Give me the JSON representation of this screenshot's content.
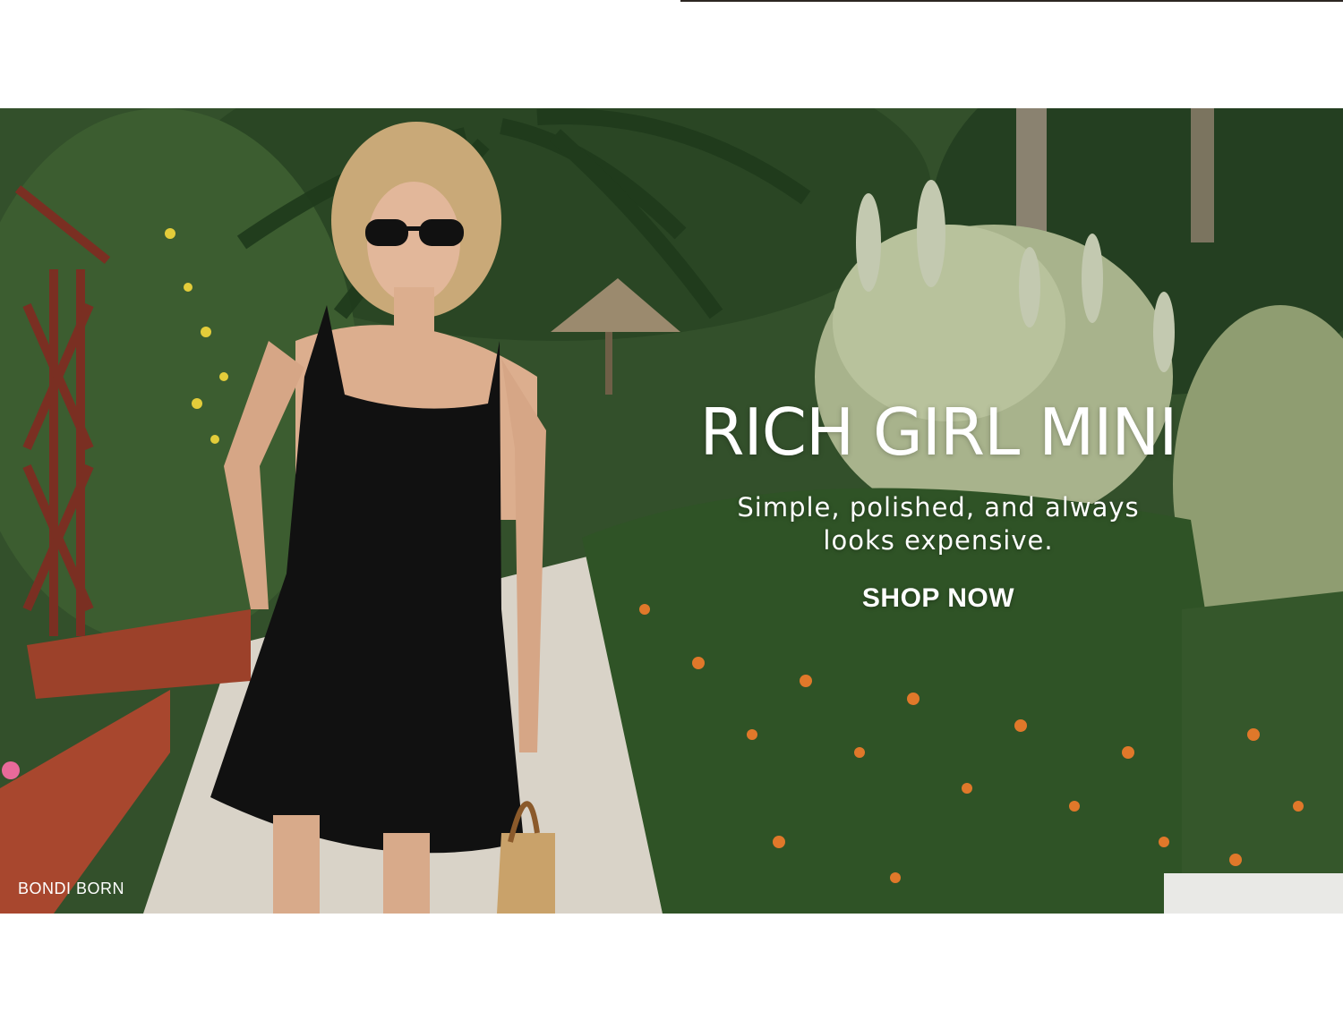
{
  "hero": {
    "headline": "RICH GIRL MINI",
    "subheadline_line1": "Simple, polished, and always",
    "subheadline_line2": "looks expensive.",
    "cta_label": "SHOP NOW",
    "caption": "BONDI BORN",
    "image_alt": "Model in black mini dress and sunglasses walking through a tropical garden"
  },
  "colors": {
    "text": "#ffffff",
    "foliage": "#35512b",
    "dress": "#111111",
    "path": "#d9d3c8",
    "brick": "#a8472e",
    "flowers": "#e0782a"
  }
}
